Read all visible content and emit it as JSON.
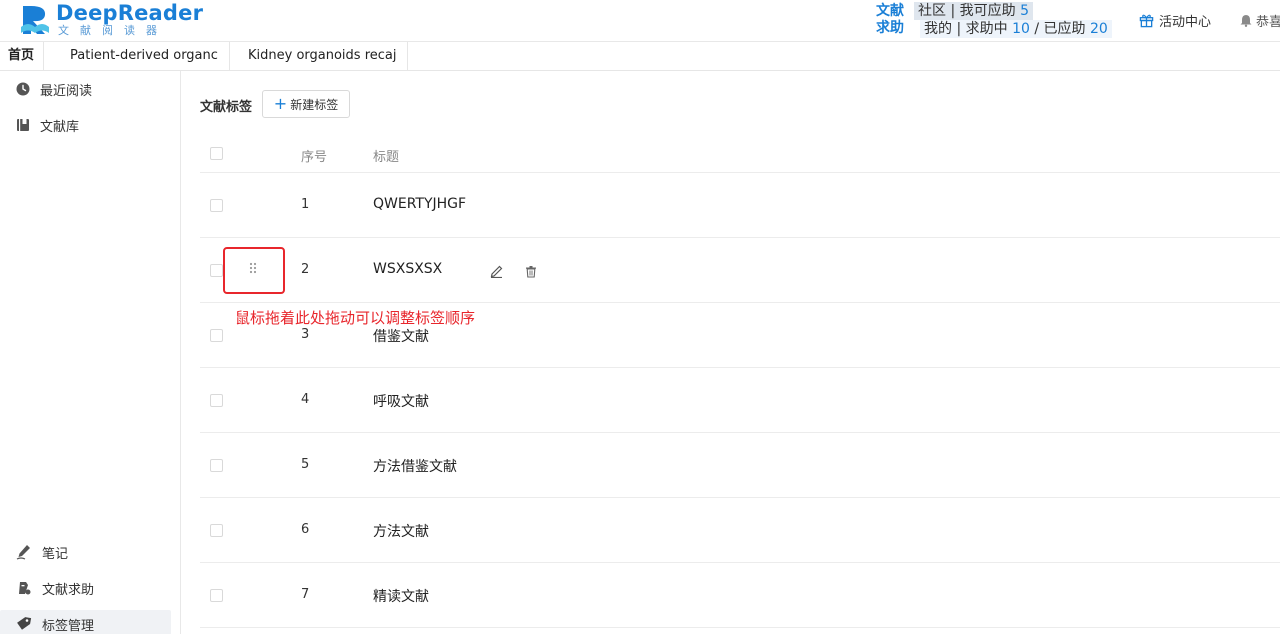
{
  "header": {
    "logo_title": "DeepReader",
    "logo_sub": "文献阅读器",
    "community_label": "文献求助",
    "community_row1_prefix": "社区 | 我可应助 ",
    "community_row1_count": "5",
    "community_row2_prefix": "我的 | 求助中 ",
    "community_row2_pending": "10",
    "community_row2_sep": " / 已应助 ",
    "community_row2_done": "20",
    "activity_label": "活动中心",
    "notice_label": "恭喜"
  },
  "tabs": [
    {
      "label": "首页"
    },
    {
      "label": "Patient-derived organc"
    },
    {
      "label": "Kidney organoids recaj"
    }
  ],
  "sidebar": {
    "top_items": [
      {
        "label": "最近阅读",
        "icon": "clock-icon"
      },
      {
        "label": "文献库",
        "icon": "book-icon"
      }
    ],
    "bottom_items": [
      {
        "label": "笔记",
        "icon": "pen-icon"
      },
      {
        "label": "文献求助",
        "icon": "help-icon"
      },
      {
        "label": "标签管理",
        "icon": "tag-icon"
      }
    ]
  },
  "main": {
    "section_title": "文献标签",
    "new_button_label": "新建标签",
    "columns": {
      "num": "序号",
      "title": "标题"
    },
    "rows": [
      {
        "num": "1",
        "title": "QWERTYJHGF"
      },
      {
        "num": "2",
        "title": "WSXSXSX"
      },
      {
        "num": "3",
        "title": "借鉴文献"
      },
      {
        "num": "4",
        "title": "呼吸文献"
      },
      {
        "num": "5",
        "title": "方法借鉴文献"
      },
      {
        "num": "6",
        "title": "方法文献"
      },
      {
        "num": "7",
        "title": "精读文献"
      }
    ],
    "drag_hint": "鼠标拖着此处拖动可以调整标签顺序"
  },
  "colors": {
    "brand": "#1a7fd6",
    "annotation": "#e8262c"
  }
}
